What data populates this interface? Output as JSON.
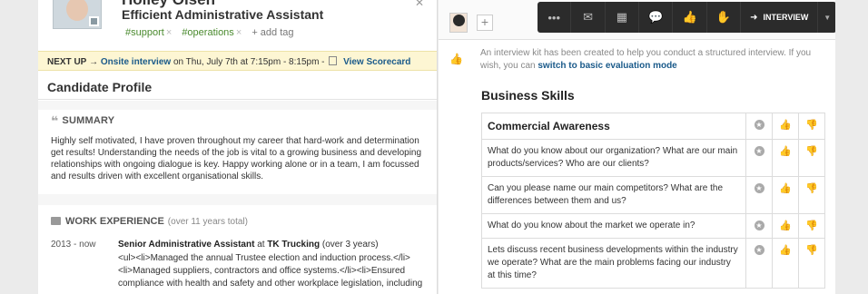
{
  "candidate": {
    "name": "Holley Olsen",
    "title": "Efficient Administrative Assistant",
    "tags": [
      "#support",
      "#operations"
    ],
    "add_tag_label": "+ add tag"
  },
  "next_up": {
    "label": "NEXT UP",
    "arrow": "→",
    "event_link": "Onsite interview",
    "event_time": "on Thu, July 7th at 7:15pm - 8:15pm -",
    "scorecard_link": "View Scorecard"
  },
  "profile": {
    "heading": "Candidate Profile",
    "summary_heading": "SUMMARY",
    "summary_text": "Highly self motivated, I have proven throughout my career that hard-work and determination get results! Understanding the needs of the job is vital to a growing business and developing relationships with ongoing dialogue is key. Happy working alone or in a team, I am focussed and results driven with excellent organisational skills.",
    "work_heading": "WORK EXPERIENCE",
    "work_sub": "(over 11 years total)",
    "work_date": "2013 - now",
    "work_role": "Senior Administrative Assistant",
    "work_at": "at",
    "work_company": "TK Trucking",
    "work_duration": "(over 3 years)",
    "work_desc": "<ul><li>Managed the annual Trustee election and induction process.</li><li>Managed suppliers, contractors and office systems.</li><li>Ensured compliance with health and safety and other workplace legislation, including"
  },
  "toolbar": {
    "interview_label": "INTERVIEW",
    "icons": [
      "more-icon",
      "email-icon",
      "calendar-icon",
      "comment-icon",
      "thumbs-icon",
      "stop-icon"
    ]
  },
  "kit": {
    "message": "An interview kit has been created to help you conduct a structured interview. If you wish, you can",
    "link": "switch to basic evaluation mode"
  },
  "business_skills": {
    "title": "Business Skills",
    "rows": [
      {
        "text": "Commercial Awareness",
        "head": true
      },
      {
        "text": "What do you know about our organization? What are our main products/services? Who are our clients?"
      },
      {
        "text": "Can you please name our main competitors? What are the differences between them and us?"
      },
      {
        "text": "What do you know about the market we operate in?"
      },
      {
        "text": "Lets discuss recent business developments within the industry we operate? What are the main problems facing our industry at this time?"
      }
    ]
  }
}
